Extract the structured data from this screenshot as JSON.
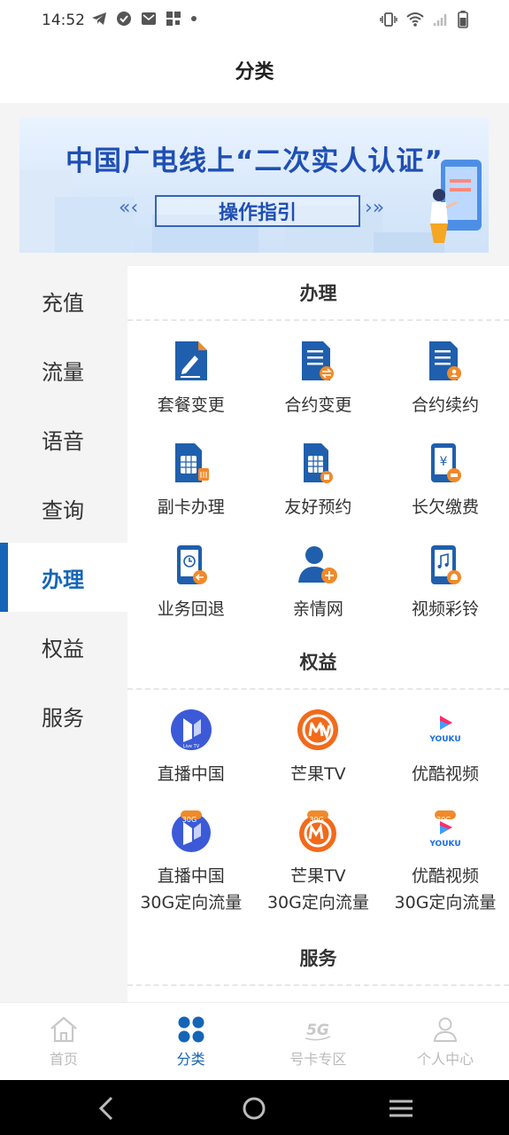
{
  "status_bar": {
    "time": "14:52"
  },
  "page_title": "分类",
  "banner": {
    "title": "中国广电线上“二次实人认证”",
    "subtitle": "操作指引",
    "arrows_left": "«‹",
    "arrows_right": "›»"
  },
  "sidebar": {
    "items": [
      {
        "label": "充值"
      },
      {
        "label": "流量"
      },
      {
        "label": "语音"
      },
      {
        "label": "查询"
      },
      {
        "label": "办理"
      },
      {
        "label": "权益"
      },
      {
        "label": "服务"
      }
    ],
    "active_index": 4
  },
  "sections": {
    "banli": {
      "title": "办理",
      "items": [
        {
          "label": "套餐变更",
          "icon": "doc-pen-icon"
        },
        {
          "label": "合约变更",
          "icon": "contract-exchange-icon"
        },
        {
          "label": "合约续约",
          "icon": "contract-user-icon"
        },
        {
          "label": "副卡办理",
          "icon": "sim-card-icon"
        },
        {
          "label": "友好预约",
          "icon": "sim-card-reserve-icon"
        },
        {
          "label": "长欠缴费",
          "icon": "phone-yen-icon"
        },
        {
          "label": "业务回退",
          "icon": "phone-clock-back-icon"
        },
        {
          "label": "亲情网",
          "icon": "family-user-plus-icon"
        },
        {
          "label": "视频彩铃",
          "icon": "phone-music-bell-icon"
        }
      ]
    },
    "quanyi": {
      "title": "权益",
      "items": [
        {
          "label": "直播中国",
          "icon": "livetv-icon"
        },
        {
          "label": "芒果TV",
          "icon": "mango-tv-icon"
        },
        {
          "label": "优酷视频",
          "icon": "youku-icon"
        }
      ],
      "items_30g": [
        {
          "label1": "直播中国",
          "label2": "30G定向流量",
          "badge": "30G",
          "icon": "livetv-icon"
        },
        {
          "label1": "芒果TV",
          "label2": "30G定向流量",
          "badge": "30G",
          "icon": "mango-tv-icon"
        },
        {
          "label1": "优酷视频",
          "label2": "30G定向流量",
          "badge": "30G",
          "icon": "youku-icon"
        }
      ]
    },
    "fuwu": {
      "title": "服务"
    }
  },
  "bottom_nav": {
    "items": [
      {
        "label": "首页"
      },
      {
        "label": "分类"
      },
      {
        "label": "号卡专区"
      },
      {
        "label": "个人中心"
      }
    ],
    "active_index": 1
  },
  "colors": {
    "accent": "#1565b6",
    "icon_blue": "#1f5fad",
    "icon_orange": "#f08a2a"
  }
}
